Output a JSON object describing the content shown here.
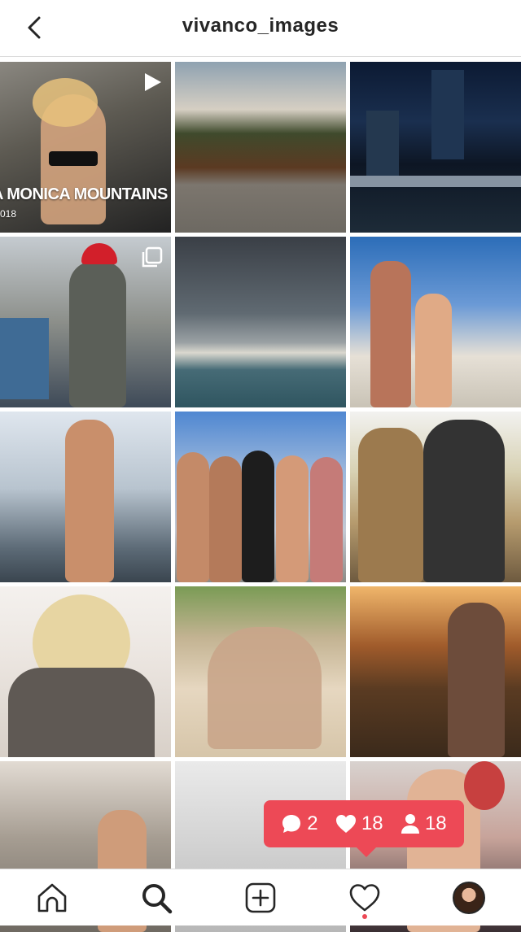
{
  "header": {
    "title": "vivanco_images",
    "back_icon": "chevron-left-icon"
  },
  "grid": {
    "tiles": [
      {
        "desc": "video",
        "badge": "play-icon",
        "overlay_text": "A MONICA MOUNTAINS",
        "overlay_sub": "018",
        "colors": [
          "#6d6a63",
          "#2b2b2a"
        ]
      },
      {
        "colors": [
          "#b7c2cc",
          "#6b7b86"
        ]
      },
      {
        "colors": [
          "#0a1424",
          "#2b5274"
        ]
      },
      {
        "badge": "carousel-icon",
        "colors": [
          "#c9cdd1",
          "#5a5d59"
        ]
      },
      {
        "colors": [
          "#3a3f46",
          "#6a7b83"
        ]
      },
      {
        "colors": [
          "#2c6db8",
          "#f1e7dc"
        ]
      },
      {
        "colors": [
          "#dfe6ee",
          "#6b7985"
        ]
      },
      {
        "colors": [
          "#4f87d1",
          "#c4c9d3"
        ]
      },
      {
        "colors": [
          "#f2f2f0",
          "#8a7a5a"
        ]
      },
      {
        "colors": [
          "#f4f1ee",
          "#c4bcb4"
        ]
      },
      {
        "colors": [
          "#e6d7c0",
          "#b99f7c"
        ]
      },
      {
        "colors": [
          "#f0b66b",
          "#3b2a1b"
        ]
      },
      {
        "colors": [
          "#cfc7bd",
          "#6f6a62"
        ]
      },
      {
        "colors": [
          "#eaeaea",
          "#b7b7b7"
        ]
      },
      {
        "colors": [
          "#d8d2cf",
          "#c7403f"
        ]
      }
    ]
  },
  "activity": {
    "comments": "2",
    "likes": "18",
    "followers": "18",
    "color": "#ed4956"
  },
  "nav": {
    "items": [
      "home-icon",
      "search-icon",
      "add-icon",
      "heart-icon",
      "profile-avatar"
    ]
  }
}
